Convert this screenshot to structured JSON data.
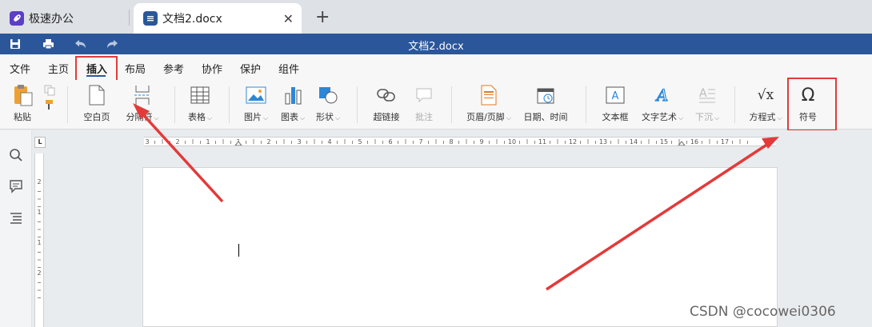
{
  "tabs": [
    {
      "label": "极速办公",
      "active": false
    },
    {
      "label": "文档2.docx",
      "active": true
    }
  ],
  "window": {
    "title": "文档2.docx"
  },
  "menu": [
    "文件",
    "主页",
    "插入",
    "布局",
    "参考",
    "协作",
    "保护",
    "组件"
  ],
  "active_menu": "插入",
  "ribbon": {
    "paste": "粘贴",
    "blank_page": "空白页",
    "break": "分隔符",
    "table": "表格",
    "image": "图片",
    "chart": "图表",
    "shape": "形状",
    "hyperlink": "超链接",
    "comment": "批注",
    "header_footer": "页眉/页脚",
    "datetime": "日期、时间",
    "textbox": "文本框",
    "wordart": "文字艺术",
    "dropcap": "下沉",
    "equation": "方程式",
    "symbol": "符号",
    "symbol_glyph": "Ω",
    "equation_glyph": "√x"
  },
  "ruler": {
    "corner": "L",
    "h_ticks": [
      "3",
      "2",
      "1",
      "1",
      "2",
      "3",
      "4",
      "5",
      "6",
      "7",
      "8",
      "9",
      "10",
      "11",
      "12",
      "13",
      "14",
      "15",
      "16",
      "17"
    ],
    "v_ticks": [
      "2",
      "1",
      "1",
      "2"
    ]
  },
  "watermark": "CSDN @cocowei0306",
  "colors": {
    "accent": "#2b579a",
    "highlight": "#e33a3a"
  }
}
